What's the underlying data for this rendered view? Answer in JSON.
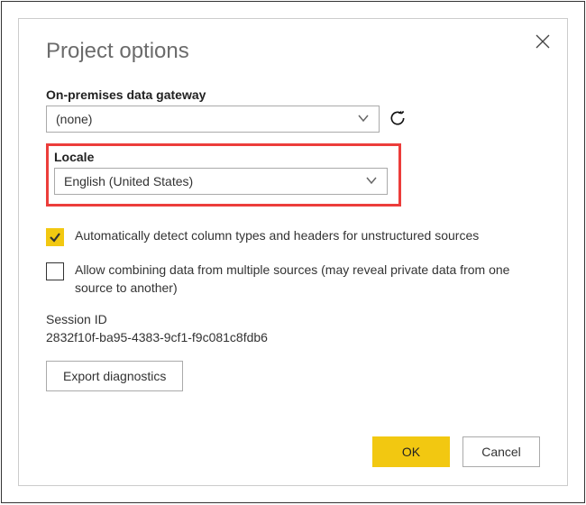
{
  "dialog": {
    "title": "Project options",
    "gateway": {
      "label": "On-premises data gateway",
      "value": "(none)"
    },
    "locale": {
      "label": "Locale",
      "value": "English (United States)"
    },
    "opt_autodetect": {
      "checked": true,
      "text": "Automatically detect column types and headers for unstructured sources"
    },
    "opt_combine": {
      "checked": false,
      "text": "Allow combining data from multiple sources (may reveal private data from one source to another)"
    },
    "session": {
      "label": "Session ID",
      "value": "2832f10f-ba95-4383-9cf1-f9c081c8fdb6"
    },
    "buttons": {
      "export": "Export diagnostics",
      "ok": "OK",
      "cancel": "Cancel"
    }
  }
}
